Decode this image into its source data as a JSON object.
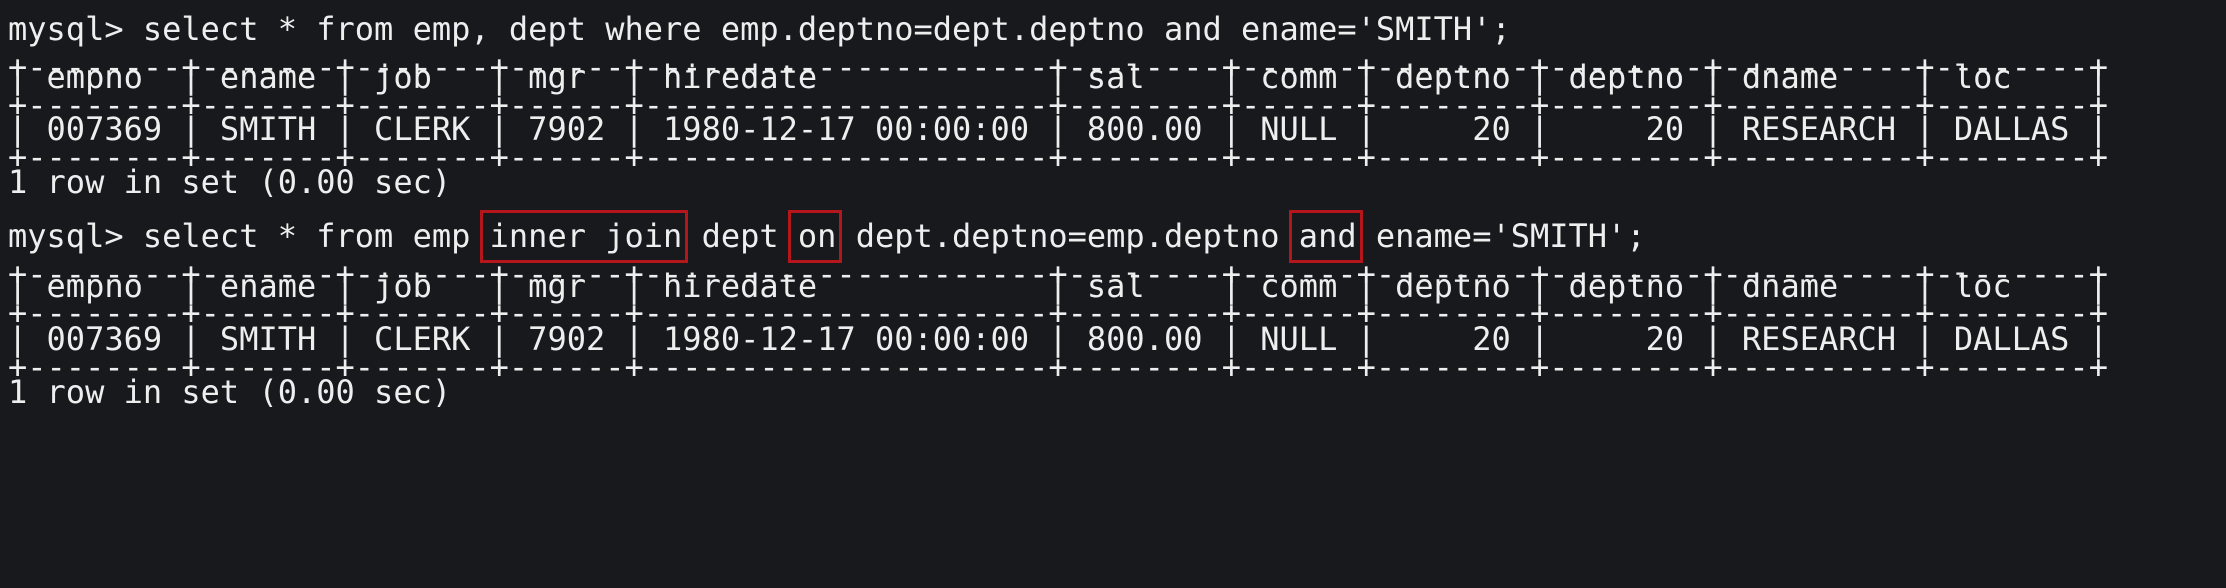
{
  "accent_colors": {
    "background": "#18191c",
    "text": "#eeeeee",
    "highlight_box": "#b4161b"
  },
  "query1": {
    "prompt": "mysql> ",
    "sql": "select * from emp, dept where emp.deptno=dept.deptno and ename='SMITH';",
    "result": {
      "border": "+--------+-------+-------+------+---------------------+--------+------+--------+--------+----------+--------+",
      "header": "| empno  | ename | job   | mgr  | hiredate            | sal    | comm | deptno | deptno | dname    | loc    |",
      "row": "| 007369 | SMITH | CLERK | 7902 | 1980-12-17 00:00:00 | 800.00 | NULL |     20 |     20 | RESEARCH | DALLAS |",
      "status": "1 row in set (0.00 sec)"
    }
  },
  "query2": {
    "prompt": "mysql> ",
    "seg1": "select * from emp ",
    "kw_inner_join": "inner join",
    "seg2": " dept ",
    "kw_on": "on",
    "seg3": " dept.deptno=emp.deptno ",
    "kw_and": "and",
    "seg4": " ename='SMITH';",
    "result": {
      "border": "+--------+-------+-------+------+---------------------+--------+------+--------+--------+----------+--------+",
      "header": "| empno  | ename | job   | mgr  | hiredate            | sal    | comm | deptno | deptno | dname    | loc    |",
      "row": "| 007369 | SMITH | CLERK | 7902 | 1980-12-17 00:00:00 | 800.00 | NULL |     20 |     20 | RESEARCH | DALLAS |",
      "status": "1 row in set (0.00 sec)"
    }
  }
}
